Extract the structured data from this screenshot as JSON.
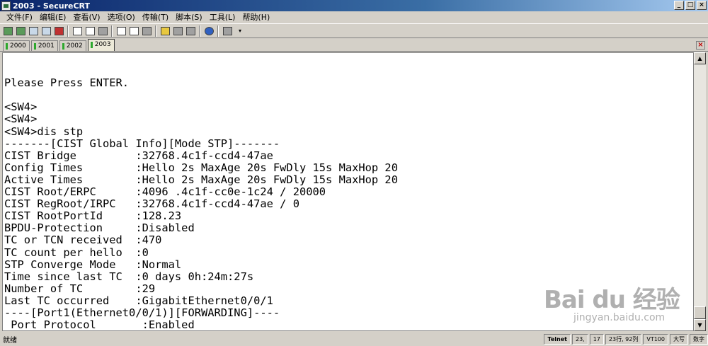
{
  "window": {
    "title": "2003 - SecureCRT",
    "minimize": "_",
    "maximize": "□",
    "close": "×"
  },
  "menu": [
    "文件(F)",
    "编辑(E)",
    "查看(V)",
    "选项(O)",
    "传输(T)",
    "脚本(S)",
    "工具(L)",
    "帮助(H)"
  ],
  "toolbar": {
    "icons": [
      "connect-icon",
      "quick-connect-icon",
      "connect-in-tab-icon",
      "reconnect-icon",
      "disconnect-icon",
      "copy-icon",
      "paste-icon",
      "find-icon",
      "print-icon",
      "print-setup-icon",
      "print-preview-icon",
      "session-options-icon",
      "global-options-icon",
      "keymap-icon",
      "help-icon",
      "monitor-icon"
    ]
  },
  "tabs": [
    {
      "label": "2000",
      "active": false
    },
    {
      "label": "2001",
      "active": false
    },
    {
      "label": "2002",
      "active": false
    },
    {
      "label": "2003",
      "active": true
    }
  ],
  "terminal": {
    "lines": [
      "",
      "",
      "Please Press ENTER.",
      "",
      "<SW4>",
      "<SW4>",
      "<SW4>dis stp",
      "-------[CIST Global Info][Mode STP]-------",
      "CIST Bridge         :32768.4c1f-ccd4-47ae",
      "Config Times        :Hello 2s MaxAge 20s FwDly 15s MaxHop 20",
      "Active Times        :Hello 2s MaxAge 20s FwDly 15s MaxHop 20",
      "CIST Root/ERPC      :4096 .4c1f-cc0e-1c24 / 20000",
      "CIST RegRoot/IRPC   :32768.4c1f-ccd4-47ae / 0",
      "CIST RootPortId     :128.23",
      "BPDU-Protection     :Disabled",
      "TC or TCN received  :470",
      "TC count per hello  :0",
      "STP Converge Mode   :Normal",
      "Time since last TC  :0 days 0h:24m:27s",
      "Number of TC        :29",
      "Last TC occurred    :GigabitEthernet0/0/1",
      "----[Port1(Ethernet0/0/1)][FORWARDING]----",
      " Port Protocol       :Enabled"
    ]
  },
  "status": {
    "ready": "就绪",
    "protocol": "Telnet",
    "cursor_row": "23,",
    "cursor_col": "17",
    "size": "23行, 92列",
    "emulation": "VT100",
    "caps": "大写",
    "num": "数字"
  },
  "watermark": {
    "logo": "Bai du 经验",
    "site": "jingyan.baidu.com"
  }
}
